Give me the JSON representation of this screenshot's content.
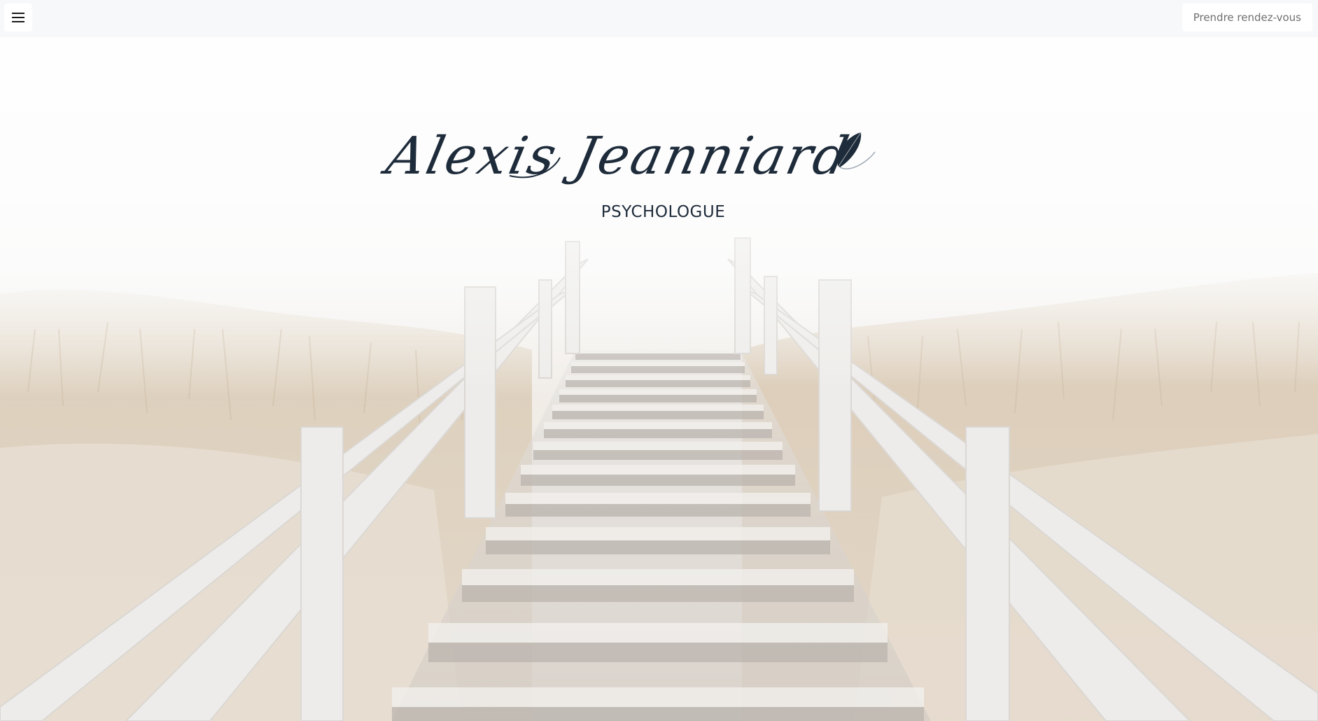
{
  "topbar": {
    "menu_icon": "hamburger-icon",
    "cta_label": "Prendre rendez-vous"
  },
  "hero": {
    "name": "Alexis Jeanniard",
    "logo_icon": "feather-quill-icon",
    "subtitle": "PSYCHOLOGUE",
    "background": "wooden staircase through dune grass in fog"
  },
  "colors": {
    "ink": "#1e2b3a",
    "topbar_bg": "#f6f7f9",
    "button_text": "#6f6f6f"
  }
}
